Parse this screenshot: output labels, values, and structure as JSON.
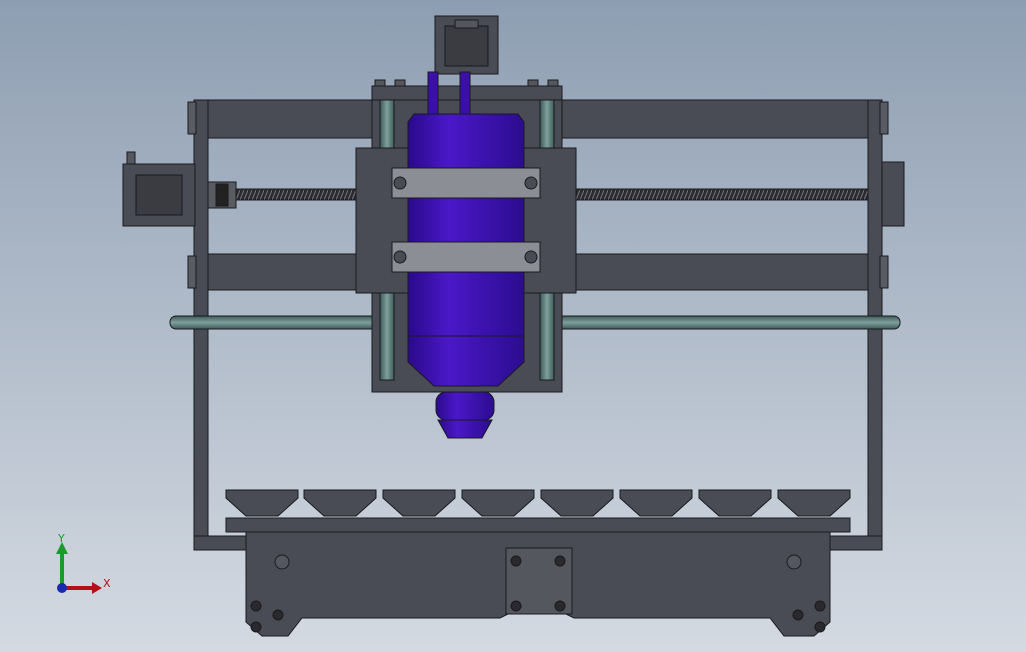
{
  "scene": {
    "view": "front",
    "background_top": "#8e9eb2",
    "background_bottom": "#d4dae2",
    "frame_color": "#4a4c55",
    "edge_color": "#1a1a1e",
    "spindle_color": "#3a10a8",
    "rod_color": "#5a7a78",
    "clamp_color": "#8c8e96"
  },
  "triad": {
    "y_label": "Y",
    "x_label": "X",
    "y_color": "#1a9a2a",
    "x_color": "#b4101a",
    "z_color": "#1a2ab0"
  }
}
